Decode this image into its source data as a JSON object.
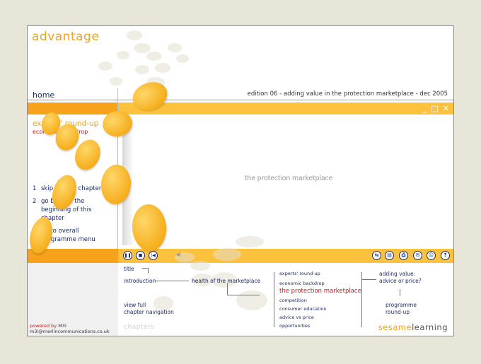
{
  "header": {
    "logo": "advantage",
    "home": "home",
    "edition": "edition 06 - adding value in the protection marketplace - dec 2005"
  },
  "sidebar": {
    "section_title": "experts' round-up",
    "section_subtitle": "economic backdrop",
    "menu": [
      {
        "num": "1",
        "label": "skip to next chapter"
      },
      {
        "num": "2",
        "label": "go back to the beginning of this chapter"
      },
      {
        "num": "3",
        "label": "go to overall programme menu"
      }
    ]
  },
  "stage": {
    "text": "the protection marketplace"
  },
  "window_controls": [
    "_",
    "□",
    "✕"
  ],
  "player": {
    "controls": [
      {
        "name": "pause-button",
        "glyph": "❚❚"
      },
      {
        "name": "stop-button",
        "glyph": "■"
      },
      {
        "name": "rewind-button",
        "glyph": "|◀"
      },
      {
        "name": "volume-button",
        "glyph": "◀)"
      }
    ]
  },
  "toolbar": [
    {
      "name": "swap-icon",
      "glyph": "⇆"
    },
    {
      "name": "notes-icon",
      "glyph": "▤"
    },
    {
      "name": "print-icon",
      "glyph": "⎙"
    },
    {
      "name": "email-icon",
      "glyph": "✉"
    },
    {
      "name": "smiley-icon",
      "glyph": "☺"
    },
    {
      "name": "help-icon",
      "glyph": "?"
    }
  ],
  "chapters": {
    "title": "title",
    "introduction": "introduction",
    "health": "health of the marketplace",
    "view_full_1": "view full",
    "view_full_2": "chapter navigation",
    "sub": [
      "experts' round-up",
      "economic backdrop",
      "the protection marketplace",
      "competition",
      "consumer education",
      "advice vs price",
      "opportunities"
    ],
    "adding_value_1": "adding value:",
    "adding_value_2": "advice or price?",
    "programme_1": "programme",
    "programme_2": "round-up",
    "label": "chapters"
  },
  "footer": {
    "powered_by": "powered by",
    "m3i": "M3i",
    "email": "m3i@merlincommunications.co.uk",
    "brand_light": "sesame",
    "brand_dark": "learning"
  },
  "colors": {
    "orange": "#f7a21b",
    "yellow": "#fdc23d",
    "navy": "#1a2a6c",
    "red": "#cc1a1a"
  }
}
